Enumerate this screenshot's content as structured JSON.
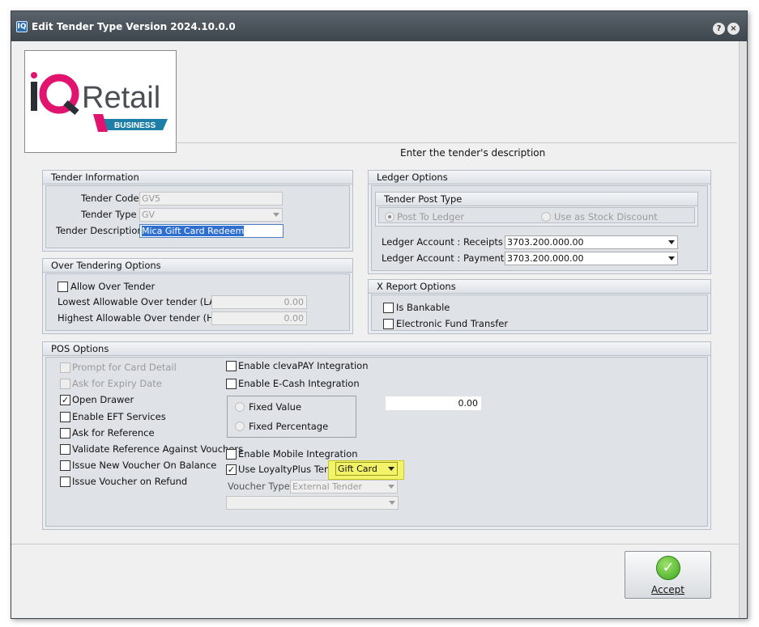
{
  "window": {
    "title": "Edit Tender Type Version 2024.10.0.0",
    "help_glyph": "?",
    "close_glyph": "×"
  },
  "logo": {
    "brand_i": "i",
    "brand_q": "Q",
    "brand_retail": "Retail",
    "banner": "BUSINESS"
  },
  "hint": "Enter the tender's description",
  "tender_info": {
    "header": "Tender Information",
    "code_label": "Tender Code",
    "code_value": "GV5",
    "type_label": "Tender Type",
    "type_value": "GV",
    "desc_label": "Tender  Description",
    "desc_value": "Mica Gift Card Redeem"
  },
  "over_tendering": {
    "header": "Over Tendering Options",
    "allow_label": "Allow Over Tender",
    "lalo_label": "Lowest Allowable Over tender (LALO)",
    "lalo_value": "0.00",
    "halo_label": "Highest Allowable Over tender (HALO)",
    "halo_value": "0.00"
  },
  "ledger": {
    "header": "Ledger Options",
    "post_type_header": "Tender Post Type",
    "post_to_ledger": "Post To Ledger",
    "stock_discount": "Use as Stock Discount",
    "receipts_label": "Ledger Account : Receipts",
    "receipts_value": "3703.200.000.00",
    "payments_label": "Ledger Account : Payments",
    "payments_value": "3703.200.000.00"
  },
  "x_report": {
    "header": "X Report Options",
    "bankable": "Is Bankable",
    "eft": "Electronic Fund Transfer"
  },
  "pos": {
    "header": "POS Options",
    "prompt_card": "Prompt for Card Detail",
    "ask_expiry": "Ask for Expiry Date",
    "open_drawer": "Open Drawer",
    "enable_eft": "Enable EFT Services",
    "ask_ref": "Ask for Reference",
    "validate_ref": "Validate Reference Against Vouchers",
    "issue_new_voucher": "Issue New Voucher On Balance",
    "issue_refund": "Issue Voucher on Refund",
    "clevapay": "Enable clevaPAY Integration",
    "ecash": "Enable E-Cash Integration",
    "fixed_value": "Fixed Value",
    "fixed_pct": "Fixed Percentage",
    "amount": "0.00",
    "mobile": "Enable Mobile Integration",
    "loyalty": "Use LoyaltyPlus Tender",
    "loyalty_value": "Gift Card",
    "voucher_types_label": "Voucher Types",
    "voucher_types_value": "External Tender",
    "extra_value": ""
  },
  "accept": {
    "label": "Accept"
  },
  "check_glyph": "✓"
}
